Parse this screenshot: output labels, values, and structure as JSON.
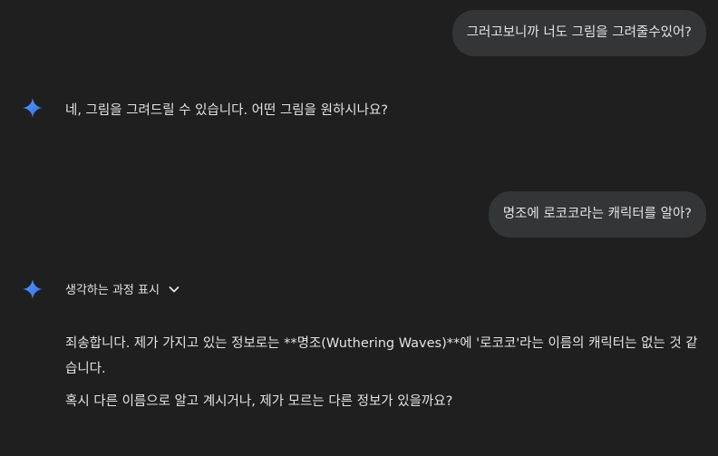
{
  "conversation": {
    "user_msg_1": "그러고보니까 너도 그림을 그려줄수있어?",
    "model_msg_1": "네, 그림을 그려드릴 수 있습니다. 어떤 그림을 원하시나요?",
    "user_msg_2": "명조에 로코코라는 캐릭터를 알아?",
    "thinking_label": "생각하는 과정 표시",
    "model_msg_2_p1": "죄송합니다. 제가 가지고 있는 정보로는 **명조(Wuthering Waves)**에 '로코코'라는 이름의 캐릭터는 없는 것 같습니다.",
    "model_msg_2_p2": "혹시 다른 이름으로 알고 계시거나, 제가 모르는 다른 정보가 있을까요?"
  },
  "icons": {
    "model_avatar": "gemini-sparkle-icon",
    "expand": "chevron-down-icon"
  },
  "colors": {
    "background": "#1f1f1f",
    "user_bubble": "#333537",
    "text": "#e3e3e3",
    "sparkle_start": "#4a8df8",
    "sparkle_end": "#2f6de0"
  }
}
